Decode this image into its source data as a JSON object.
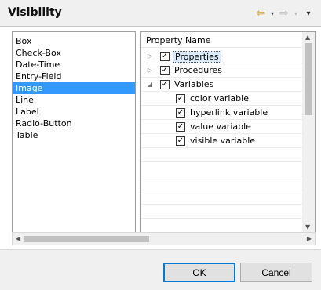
{
  "header": {
    "title": "Visibility",
    "back_icon": "⇦",
    "forward_icon": "⇨",
    "dropdown_glyph": "▾"
  },
  "left_list": {
    "items": [
      "Box",
      "Check-Box",
      "Date-Time",
      "Entry-Field",
      "Image",
      "Line",
      "Label",
      "Radio-Button",
      "Table"
    ],
    "selected": "Image"
  },
  "tree": {
    "column_header": "Property Name",
    "rows": [
      {
        "label": "Properties",
        "expander": "▷",
        "checked": true,
        "focused": true
      },
      {
        "label": "Procedures",
        "expander": "▷",
        "checked": true,
        "focused": false
      },
      {
        "label": "Variables",
        "expander": "◢",
        "checked": true,
        "focused": false
      },
      {
        "label": "color variable",
        "expander": "",
        "checked": true,
        "focused": false
      },
      {
        "label": "hyperlink variable",
        "expander": "",
        "checked": true,
        "focused": false
      },
      {
        "label": "value variable",
        "expander": "",
        "checked": true,
        "focused": false
      },
      {
        "label": "visible variable",
        "expander": "",
        "checked": true,
        "focused": false
      }
    ],
    "check_glyph": "✓"
  },
  "footer": {
    "ok_label": "OK",
    "cancel_label": "Cancel"
  },
  "colors": {
    "selection": "#3399ff",
    "focus_fill": "#dcebfc",
    "back_arrow": "#d49a18",
    "default_button_border": "#0078d7"
  }
}
